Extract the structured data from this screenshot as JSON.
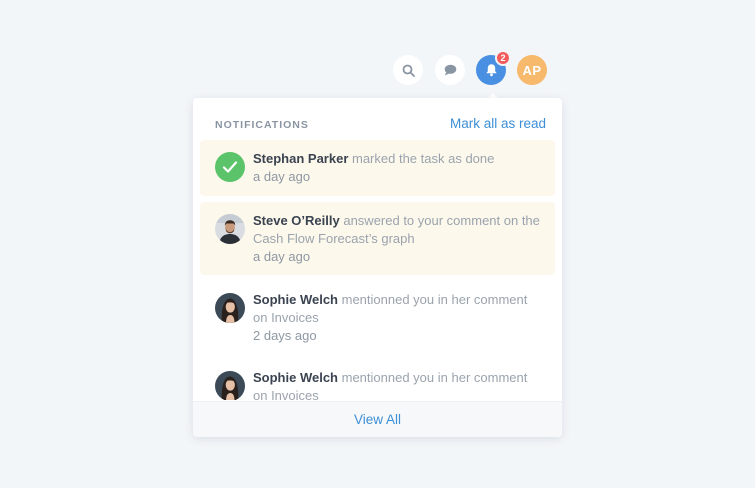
{
  "topbar": {
    "search_icon": "search-icon",
    "chat_icon": "chat-bubble-icon",
    "bell_icon": "bell-icon",
    "notification_count": "2",
    "avatar_initials": "AP",
    "accent": "#4a90e2",
    "badge_color": "#f25c5c",
    "avatar_color": "#f7b96b"
  },
  "panel": {
    "title": "NOTIFICATIONS",
    "mark_all_read": "Mark all as read",
    "view_all": "View All"
  },
  "notifications": [
    {
      "name": "Stephan Parker",
      "message": "marked the task as done",
      "time": "a day ago",
      "unread": true,
      "avatar": "check-icon"
    },
    {
      "name": "Steve O’Reilly",
      "message": "answered to your comment on the Cash Flow Forecast’s graph",
      "time": "a day ago",
      "unread": true,
      "avatar": "photo"
    },
    {
      "name": "Sophie Welch",
      "message": "mentionned you in her comment on Invoices",
      "time": "2 days ago",
      "unread": false,
      "avatar": "photo"
    },
    {
      "name": "Sophie Welch",
      "message": "mentionned you in her comment on Invoices",
      "time": "",
      "unread": false,
      "avatar": "photo"
    }
  ]
}
